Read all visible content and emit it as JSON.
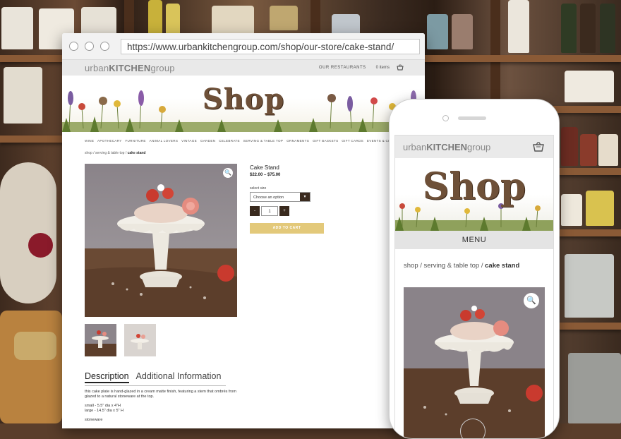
{
  "browser": {
    "url": "https://www.urbankitchengroup.com/shop/our-store/cake-stand/"
  },
  "site": {
    "logo_pre": "urban",
    "logo_brand": "KITCHEN",
    "logo_post": "group",
    "our_restaurants": "OUR RESTAURANTS",
    "cart_count": "0 items",
    "banner_title": "Shop",
    "nav": [
      "WINE",
      "APOTHECARY",
      "FURNITURE",
      "ANIMAL LOVERS",
      "VINTAGE",
      "GARDEN",
      "CELEBRATE",
      "SERVING & TABLE TOP",
      "ORNAMENTS",
      "GIFT BASKETS",
      "GIFT CARDS",
      "EVENTS & CLASSES"
    ]
  },
  "breadcrumb": {
    "home": "shop",
    "sep": " / ",
    "category": "serving & table top",
    "current": "cake stand"
  },
  "product": {
    "name": "Cake Stand",
    "price": "$22.00 – $75.00",
    "size_label": "select size",
    "size_placeholder": "Choose an option",
    "qty_minus": "-",
    "qty": "1",
    "qty_plus": "+",
    "add_to_cart": "ADD TO CART"
  },
  "tabs": {
    "description": "Description",
    "additional": "Additional Information"
  },
  "description": {
    "line1": "this cake plate is hand-glazed in a cream matte finish, featuring a stem that ombrés from glazed to a natural stoneware at the top.",
    "line2": "small - 5.5\" dia x 4\"H",
    "line3": "large - 14.5\" dia x 5\" H",
    "line4": "stoneware"
  },
  "mobile": {
    "menu": "MENU"
  },
  "icons": {
    "zoom": "magnifier-icon",
    "bag": "shopping-bag-icon"
  },
  "colors": {
    "brown_dark": "#3a2a1e",
    "cart_gold": "#e3c97a",
    "shop_brown": "#6e5038"
  }
}
